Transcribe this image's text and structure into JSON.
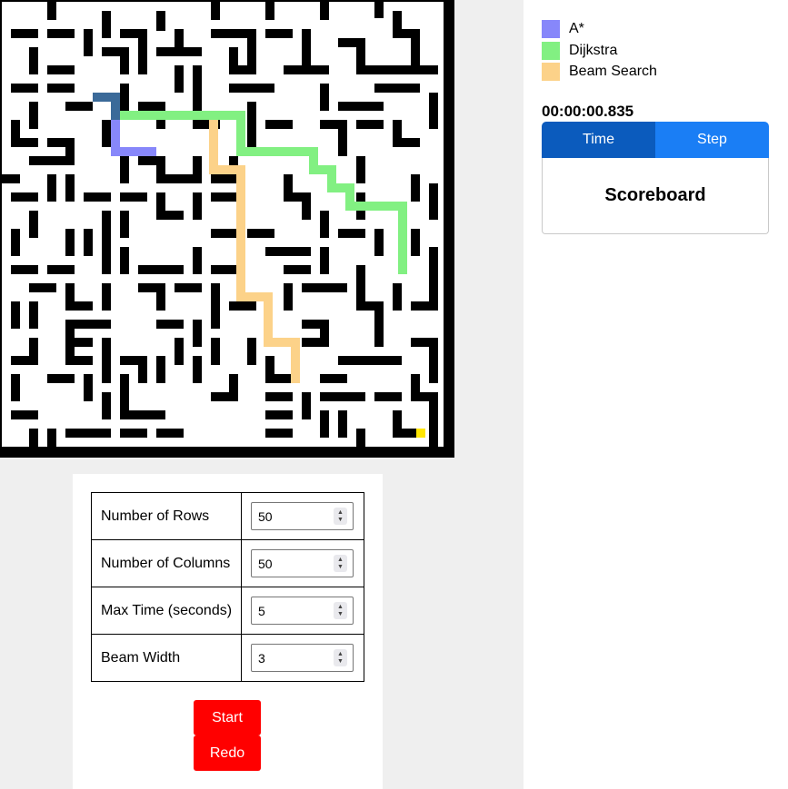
{
  "legend": [
    {
      "label": "A*",
      "color": "#8787fa"
    },
    {
      "label": "Dijkstra",
      "color": "#82f082"
    },
    {
      "label": "Beam Search",
      "color": "#fcd289"
    }
  ],
  "timer": "00:00:00.835",
  "tabs": {
    "time": "Time",
    "step": "Step"
  },
  "scoreboard_title": "Scoreboard",
  "params": [
    {
      "label": "Number of Rows",
      "value": "50"
    },
    {
      "label": "Number of Columns",
      "value": "50"
    },
    {
      "label": "Max Time (seconds)",
      "value": "5"
    },
    {
      "label": "Beam Width",
      "value": "3"
    }
  ],
  "buttons": {
    "start": "Start",
    "redo": "Redo"
  },
  "colors": {
    "wall": "#000000",
    "start_cell": "#3b6a99",
    "goal_cell": "#ffe600",
    "astar": "#8787fa",
    "dijkstra": "#82f082",
    "beam": "#fcd289",
    "button": "#ff0000",
    "tab_active": "#0b5bbd",
    "tab_inactive": "#1a7ef5"
  }
}
